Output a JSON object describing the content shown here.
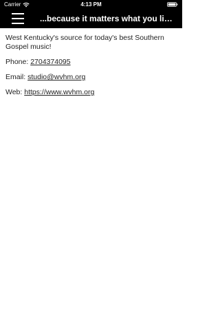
{
  "status_bar": {
    "carrier": "Carrier",
    "time": "4:13 PM",
    "wifi_icon": "wifi-icon",
    "battery_icon": "battery-icon"
  },
  "nav_bar": {
    "menu_icon": "hamburger-menu-icon",
    "title": "...because it matters what you liste..."
  },
  "content": {
    "description": "West Kentucky's source for today's best Southern Gospel music!",
    "phone_label": "Phone: ",
    "phone_value": "2704374095",
    "email_label": "Email: ",
    "email_value": "studio@wvhm.org",
    "web_label": "Web: ",
    "web_value": "https://www.wvhm.org"
  },
  "colors": {
    "bar_background": "#000000",
    "page_background": "#ffffff",
    "text": "#222222"
  }
}
